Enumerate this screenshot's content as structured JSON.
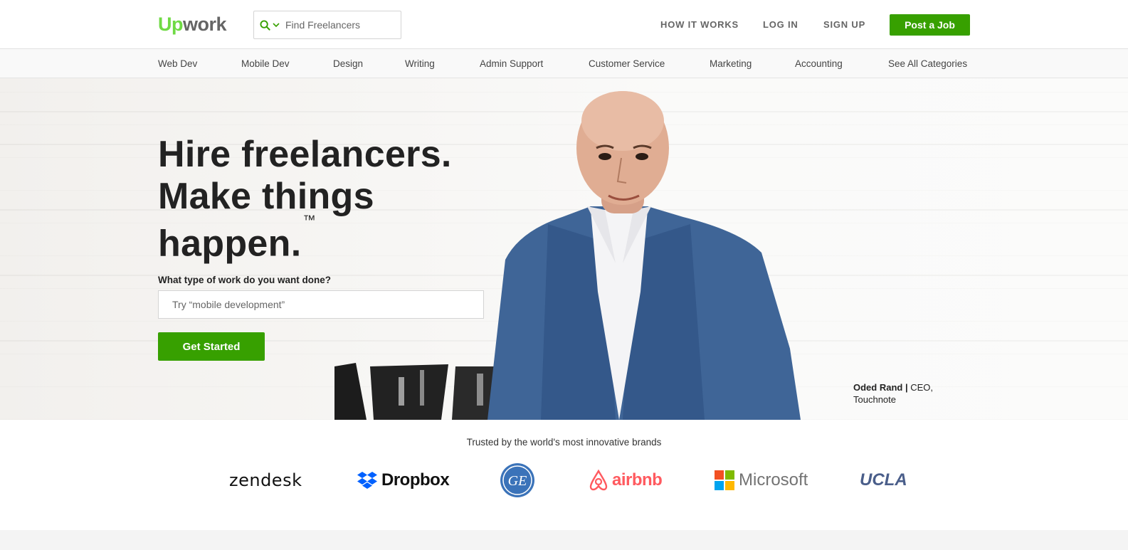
{
  "header": {
    "logo_up": "Up",
    "logo_work": "work",
    "search_placeholder": "Find Freelancers",
    "search_icon": "search-icon",
    "nav": {
      "how_it_works": "HOW IT WORKS",
      "log_in": "LOG IN",
      "sign_up": "SIGN UP"
    },
    "post_job": "Post a Job"
  },
  "categories": [
    "Web Dev",
    "Mobile Dev",
    "Design",
    "Writing",
    "Admin Support",
    "Customer Service",
    "Marketing",
    "Accounting",
    "See All Categories"
  ],
  "hero": {
    "headline_1": "Hire freelancers.",
    "headline_2": "Make things",
    "headline_3": "happen.",
    "trademark": "™",
    "question": "What type of work do you want done?",
    "input_placeholder": "Try “mobile development”",
    "cta": "Get Started",
    "caption_name": "Oded Rand |",
    "caption_role": " CEO, Touchnote"
  },
  "brands": {
    "trusted_text": "Trusted by the world's most innovative brands",
    "logos": [
      "zendesk",
      "Dropbox",
      "GE",
      "airbnb",
      "Microsoft",
      "UCLA"
    ]
  },
  "colors": {
    "accent_green": "#37a000",
    "logo_green": "#6fda44",
    "nav_gray": "#656565"
  }
}
